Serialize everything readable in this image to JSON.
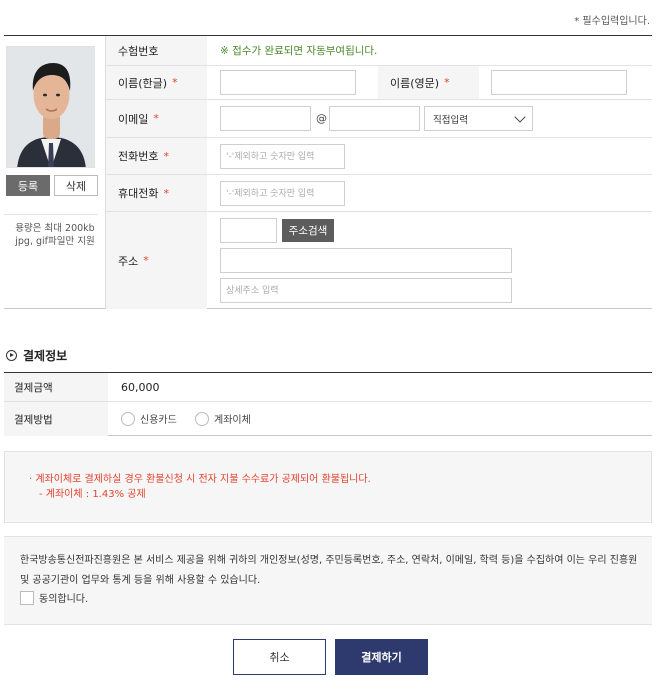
{
  "required_note": "* 필수입력입니다.",
  "photo": {
    "register_label": "등록",
    "delete_label": "삭제",
    "note_line1": "용량은 최대 200kb",
    "note_line2": "jpg, gif파일만 지원"
  },
  "form": {
    "exam_no_label": "수험번호",
    "exam_no_notice": "※ 접수가 완료되면 자동부여됩니다.",
    "name_ko_label": "이름(한글)",
    "name_en_label": "이름(영문)",
    "email_label": "이메일",
    "email_at": "@",
    "email_domain_select": "직접입력",
    "phone_label": "전화번호",
    "phone_placeholder": "'-'제외하고 숫자만 입력",
    "mobile_label": "휴대전화",
    "mobile_placeholder": "'-'제외하고 숫자만 입력",
    "address_label": "주소",
    "address_search_label": "주소검색",
    "address_detail_placeholder": "상세주소 입력",
    "required_star": "*"
  },
  "payment": {
    "section_title": "결제정보",
    "amount_label": "결제금액",
    "amount_value": "60,000",
    "method_label": "결제방법",
    "method_options": [
      "신용카드",
      "계좌이체"
    ]
  },
  "refund_notice": {
    "line1": "· 계좌이체로 결제하실 경우 환불신청 시 전자 지불 수수료가 공제되어 환불됩니다.",
    "line2": "- 계좌이체 : 1.43% 공제"
  },
  "privacy": {
    "text": "한국방송통신전파진흥원은 본 서비스 제공을 위해 귀하의 개인정보(성명, 주민등록번호, 주소, 연락처, 이메일, 학력 등)을 수집하여 이는 우리 진흥원 및 공공기관이 업무와 통계 등을 위해 사용할 수 있습니다.",
    "agree_label": "동의합니다."
  },
  "buttons": {
    "cancel_label": "취소",
    "pay_label": "결제하기"
  },
  "colors": {
    "accent": "#2e3a6e",
    "required_star": "#e0432a",
    "notice_green": "#4a8a2a",
    "notice_red": "#e2432f"
  }
}
